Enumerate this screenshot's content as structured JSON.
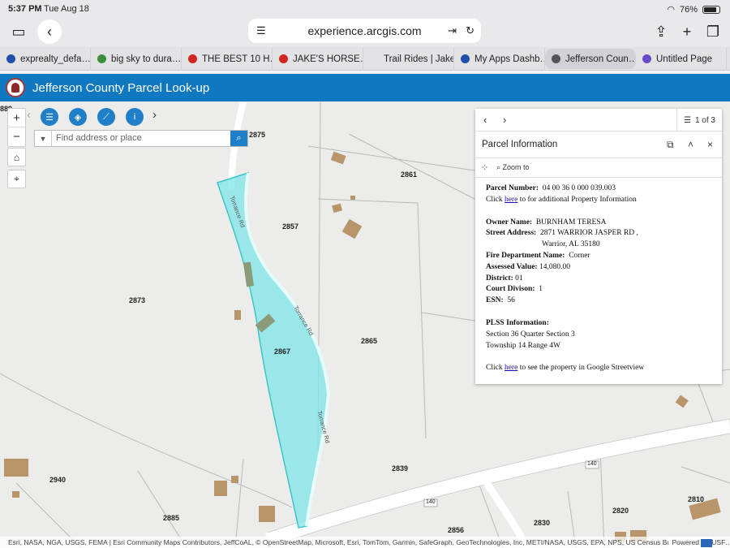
{
  "status": {
    "time": "5:37 PM",
    "date": "Tue Aug 18",
    "battery": "76%"
  },
  "browser": {
    "url": "experience.arcgis.com",
    "tabs": [
      {
        "label": "exprealty_defa…",
        "color": "#1f4fae"
      },
      {
        "label": "big sky to dura…",
        "color": "#3b8f3b"
      },
      {
        "label": "THE BEST 10 H…",
        "color": "#d32323"
      },
      {
        "label": "JAKE'S HORSE…",
        "color": "#d32323"
      },
      {
        "label": "Trail Rides | Jake…",
        "color": "#e3e3e6"
      },
      {
        "label": "My Apps Dashb…",
        "color": "#1f4fae"
      },
      {
        "label": "Jefferson Coun…",
        "color": "#555555"
      },
      {
        "label": "Untitled Page",
        "color": "#6a4bc7"
      }
    ]
  },
  "app": {
    "title": "Jefferson County Parcel Look-up"
  },
  "search": {
    "placeholder": "Find address or place"
  },
  "map": {
    "parcel_labels": [
      "2875",
      "2861",
      "2857",
      "2873",
      "2867",
      "2865",
      "2839",
      "2940",
      "2885",
      "2856",
      "2830",
      "2820",
      "2810",
      "889"
    ],
    "road_labels": [
      "Torrance Rd",
      "Torrance Rd",
      "Torrance Rd",
      "140",
      "140"
    ],
    "attribution": "Esri, NASA, NGA, USGS, FEMA | Esri Community Maps Contributors, JeffCoAL, © OpenStreetMap, Microsoft, Esri, TomTom, Garmin, SafeGraph, GeoTechnologies, Inc, METI/NASA, USGS, EPA, NPS, US Census Bureau, USDA, USF…",
    "powered_by": "Powered"
  },
  "popup": {
    "pager": "1 of 3",
    "title": "Parcel Information",
    "zoom_to": "Zoom to",
    "parcel_number_label": "Parcel Number:",
    "parcel_number": "04 00 36 0 000 039.003",
    "click1_pre": "Click ",
    "click1_link": "here",
    "click1_post": " to for additional Property Information",
    "owner_label": "Owner Name:",
    "owner": "BURNHAM TERESA",
    "street_label": "Street Address:",
    "street": "2871 WARRIOR JASPER RD ,",
    "city": "Warrior, AL  35180",
    "fire_label": "Fire Department Name:",
    "fire": "Corner",
    "assessed_label": "Assessed Value:",
    "assessed": "14,080.00",
    "district_label": "District:",
    "district": "01",
    "court_label": "Court Divison:",
    "court": "1",
    "esn_label": "ESN:",
    "esn": "56",
    "plss_label": "PLSS Information:",
    "plss_line1": "Section 36 Quarter Section 3",
    "plss_line2": "Township 14 Range 4W",
    "click2_pre": "Click ",
    "click2_link": "here",
    "click2_post": " to see the property in Google Streetview"
  }
}
